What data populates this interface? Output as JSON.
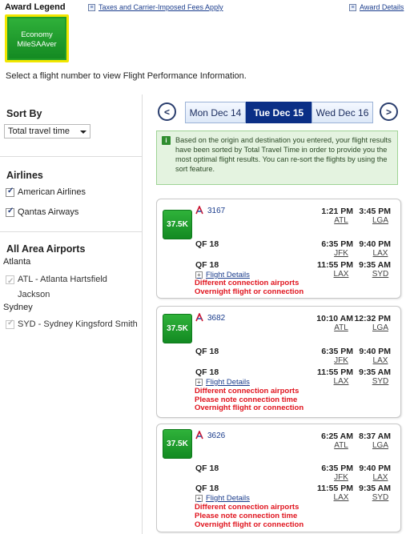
{
  "legend": {
    "title": "Award Legend",
    "taxes_link": "Taxes and Carrier-Imposed Fees Apply",
    "award_details_link": "Award Details",
    "award_type_line1": "Economy",
    "award_type_line2": "MileSAAver"
  },
  "select_message": "Select a flight number to view Flight Performance Information.",
  "sidebar": {
    "sort_title": "Sort By",
    "sort_value": "Total travel time",
    "airlines_title": "Airlines",
    "airlines": [
      {
        "label": "American Airlines",
        "checked": true
      },
      {
        "label": "Qantas Airways",
        "checked": true
      }
    ],
    "airports_title": "All Area Airports",
    "cities": [
      {
        "city": "Atlanta",
        "airport": "ATL - Atlanta Hartsfield Jackson"
      },
      {
        "city": "Sydney",
        "airport": "SYD - Sydney Kingsford Smith"
      }
    ]
  },
  "date_nav": {
    "prev_icon": "chevron-left-icon",
    "next_icon": "chevron-right-icon",
    "tabs": [
      "Mon Dec 14",
      "Tue Dec 15",
      "Wed Dec 16"
    ],
    "active_tab": "Tue Dec 15"
  },
  "info_message": "Based on the origin and destination you entered, your flight results have been sorted by Total Travel Time in order to provide you the most optimal flight results. You can re-sort the flights by using the sort feature.",
  "flights": [
    {
      "miles": "37.5K",
      "segments": [
        {
          "flight": "3167",
          "is_link": true,
          "dep_time": "1:21 PM",
          "dep_ap": "ATL",
          "arr_time": "3:45 PM",
          "arr_ap": "LGA"
        },
        {
          "flight": "QF 18",
          "is_link": false,
          "dep_time": "6:35 PM",
          "dep_ap": "JFK",
          "arr_time": "9:40 PM",
          "arr_ap": "LAX"
        },
        {
          "flight": "QF 18",
          "is_link": false,
          "dep_time": "11:55 PM",
          "dep_ap": "LAX",
          "arr_time": "9:35 AM",
          "arr_ap": "SYD"
        }
      ],
      "details_label": "Flight Details",
      "warnings": [
        "Different connection airports",
        "Overnight flight or connection"
      ]
    },
    {
      "miles": "37.5K",
      "segments": [
        {
          "flight": "3682",
          "is_link": true,
          "dep_time": "10:10 AM",
          "dep_ap": "ATL",
          "arr_time": "12:32 PM",
          "arr_ap": "LGA"
        },
        {
          "flight": "QF 18",
          "is_link": false,
          "dep_time": "6:35 PM",
          "dep_ap": "JFK",
          "arr_time": "9:40 PM",
          "arr_ap": "LAX"
        },
        {
          "flight": "QF 18",
          "is_link": false,
          "dep_time": "11:55 PM",
          "dep_ap": "LAX",
          "arr_time": "9:35 AM",
          "arr_ap": "SYD"
        }
      ],
      "details_label": "Flight Details",
      "warnings": [
        "Different connection airports",
        "Please note connection time",
        "Overnight flight or connection"
      ]
    },
    {
      "miles": "37.5K",
      "segments": [
        {
          "flight": "3626",
          "is_link": true,
          "dep_time": "6:25 AM",
          "dep_ap": "ATL",
          "arr_time": "8:37 AM",
          "arr_ap": "LGA"
        },
        {
          "flight": "QF 18",
          "is_link": false,
          "dep_time": "6:35 PM",
          "dep_ap": "JFK",
          "arr_time": "9:40 PM",
          "arr_ap": "LAX"
        },
        {
          "flight": "QF 18",
          "is_link": false,
          "dep_time": "11:55 PM",
          "dep_ap": "LAX",
          "arr_time": "9:35 AM",
          "arr_ap": "SYD"
        }
      ],
      "details_label": "Flight Details",
      "warnings": [
        "Different connection airports",
        "Please note connection time",
        "Overnight flight or connection"
      ]
    }
  ],
  "colors": {
    "award_green": "#1f9c2b",
    "award_border": "#f2e600",
    "active_tab": "#0b2f86",
    "warning_red": "#e0141e",
    "link_blue": "#1a3c8c"
  }
}
